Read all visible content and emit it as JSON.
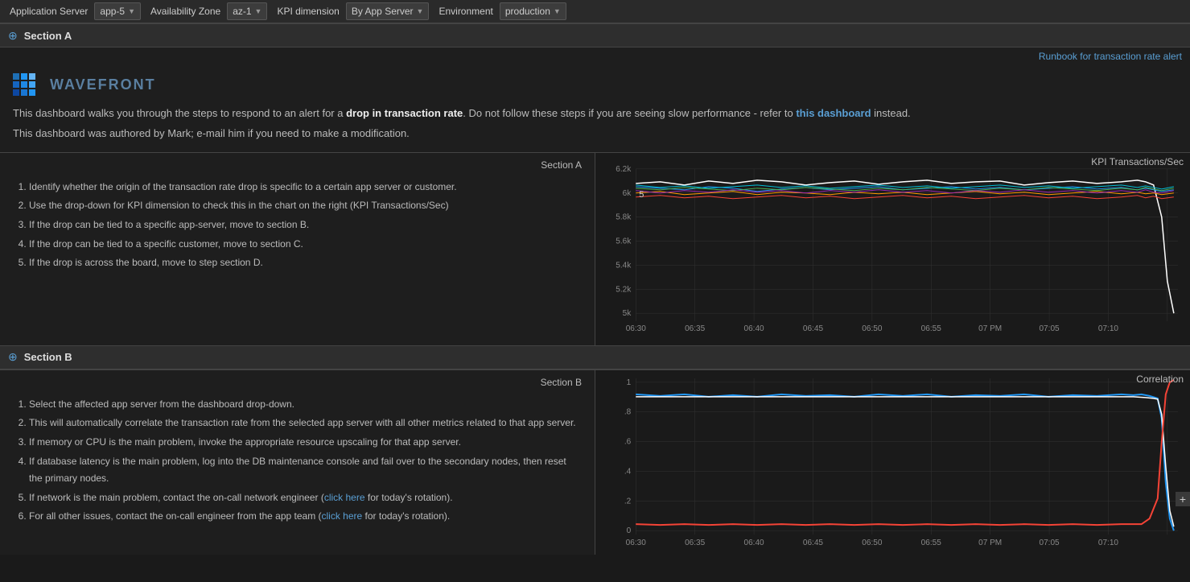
{
  "navbar": {
    "app_server_label": "Application Server",
    "app_server_value": "app-5",
    "availability_zone_label": "Availability Zone",
    "az_value": "az-1",
    "kpi_label": "KPI dimension",
    "kpi_value": "By App Server",
    "environment_label": "Environment",
    "env_value": "production"
  },
  "section_a": {
    "title": "Section A",
    "icon": "⊕"
  },
  "section_b": {
    "title": "Section B",
    "icon": "⊕"
  },
  "runbook": {
    "label": "Runbook for transaction rate alert"
  },
  "wavefront": {
    "logo_text": "WAVEFRONT",
    "header_line1_pre": "This dashboard walks you through the steps to respond to an alert for a ",
    "header_line1_bold": "drop in transaction rate",
    "header_line1_mid": ". Do not follow these steps if you are seeing slow performance - refer to ",
    "header_line1_link": "this dashboard",
    "header_line1_post": " instead.",
    "header_line2": "This dashboard was authored by Mark; e-mail him if you need to make a modification."
  },
  "section_a_panel": {
    "title": "Section A",
    "steps": [
      "Identify whether the origin of the transaction rate drop is specific to a certain app server or customer.",
      "Use the drop-down for KPI dimension to check this in the chart on the right (KPI Transactions/Sec)",
      "If the drop can be tied to a specific app-server, move to section B.",
      "If the drop can be tied to a specific customer, move to section C.",
      "If the drop is across the board, move to step section D."
    ]
  },
  "section_b_panel": {
    "title": "Section B",
    "steps": [
      "Select the affected app server from the dashboard drop-down.",
      "This will automatically correlate the transaction rate from the selected app server with all other metrics related to that app server.",
      "If memory or CPU is the main problem, invoke the appropriate resource upscaling for that app server.",
      "If database latency is the main problem, log into the DB maintenance console and fail over to the secondary nodes, then reset the primary nodes.",
      "If network is the main problem, contact the on-call network engineer (click here for today's rotation).",
      "For all other issues, contact the on-call engineer from the app team (click here for today's rotation)."
    ],
    "click_here_1": "click here",
    "click_here_2": "click here"
  },
  "chart_a": {
    "title": "KPI Transactions/Sec",
    "y_labels": [
      "6.2k",
      "6k",
      "5.8k",
      "5.6k",
      "5.4k",
      "5.2k",
      "5k"
    ],
    "x_labels": [
      "06:30",
      "06:35",
      "06:40",
      "06:45",
      "06:50",
      "06:55",
      "07 PM",
      "07:05",
      "07:10"
    ]
  },
  "chart_b": {
    "title": "Correlation",
    "y_labels": [
      "1",
      ".8",
      ".6",
      ".4",
      ".2",
      "0"
    ],
    "x_labels": [
      "06:30",
      "06:35",
      "06:40",
      "06:45",
      "06:50",
      "06:55",
      "07 PM",
      "07:05",
      "07:10"
    ]
  },
  "colors": {
    "accent": "#5a9fd4",
    "bg_dark": "#1a1a1a",
    "bg_panel": "#1e1e1e",
    "border": "#444"
  }
}
